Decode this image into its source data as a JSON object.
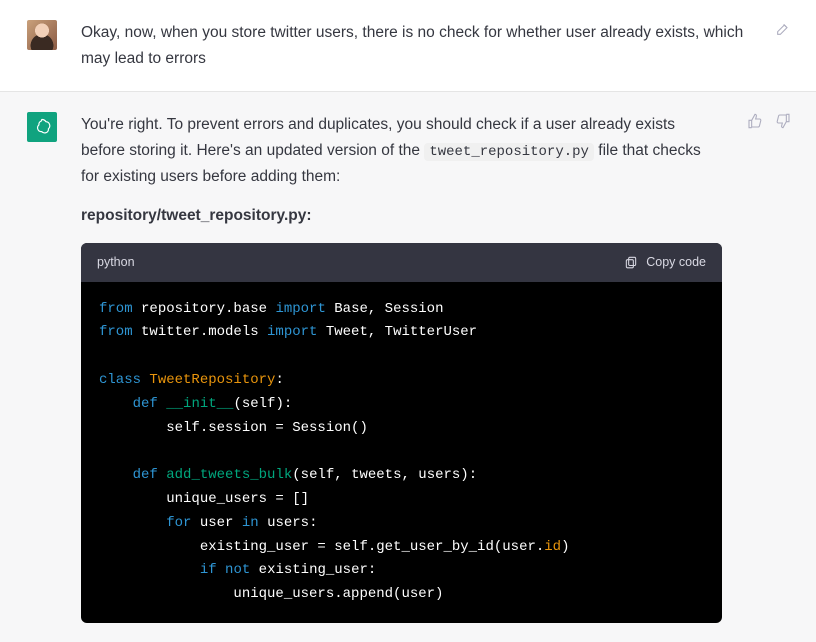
{
  "user_message": {
    "text": "Okay, now, when you store twitter users, there is no check for whether user already exists, which may lead to errors"
  },
  "ai_message": {
    "intro_pre": "You're right. To prevent errors and duplicates, you should check if a user already exists before storing it. Here's an updated version of the ",
    "inline_code": "tweet_repository.py",
    "intro_post": " file that checks for existing users before adding them:",
    "file_label": "repository/tweet_repository.py:",
    "code_lang": "python",
    "copy_label": "Copy code"
  },
  "code": {
    "l1_from": "from",
    "l1_mod": " repository.base ",
    "l1_import": "import",
    "l1_names": " Base, Session",
    "l2_from": "from",
    "l2_mod": " twitter.models ",
    "l2_import": "import",
    "l2_names": " Tweet, TwitterUser",
    "l4_class": "class",
    "l4_sp": " ",
    "l4_name": "TweetRepository",
    "l4_colon": ":",
    "l5_indent": "    ",
    "l5_def": "def",
    "l5_sp": " ",
    "l5_fn": "__init__",
    "l5_sig": "(self):",
    "l6": "        self.session = Session()",
    "l8_indent": "    ",
    "l8_def": "def",
    "l8_sp": " ",
    "l8_fn": "add_tweets_bulk",
    "l8_sig": "(self, tweets, users):",
    "l9": "        unique_users = []",
    "l10_indent": "        ",
    "l10_for": "for",
    "l10_mid": " user ",
    "l10_in": "in",
    "l10_rest": " users:",
    "l11_pre": "            existing_user = self.get_user_by_id(user.",
    "l11_id": "id",
    "l11_post": ")",
    "l12_indent": "            ",
    "l12_if": "if",
    "l12_sp": " ",
    "l12_not": "not",
    "l12_rest": " existing_user:",
    "l13": "                unique_users.append(user)"
  },
  "icons": {
    "edit": "edit-icon",
    "thumbs_up": "thumbs-up-icon",
    "thumbs_down": "thumbs-down-icon",
    "clipboard": "clipboard-icon",
    "openai": "openai-logo"
  }
}
